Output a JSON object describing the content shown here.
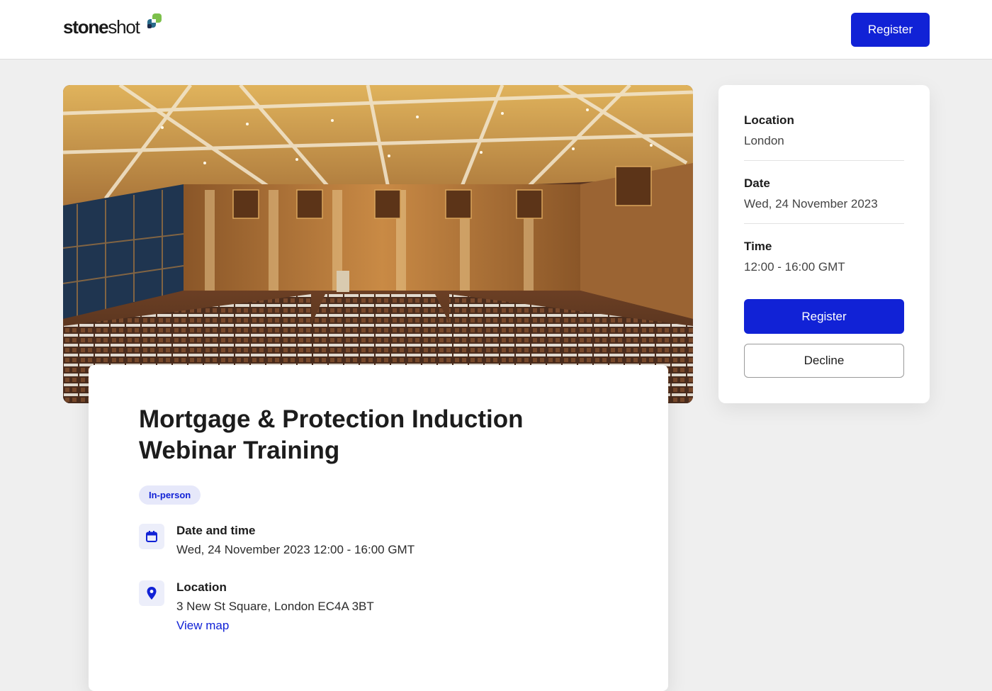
{
  "header": {
    "logo_bold": "stone",
    "logo_light": "shot",
    "register_label": "Register"
  },
  "event": {
    "title": "Mortgage & Protection Induction Webinar Training",
    "badge": "In-person",
    "hero_image": "conference-hall-photo",
    "date_time": {
      "label": "Date and time",
      "value": "Wed, 24 November 2023 12:00 - 16:00 GMT",
      "icon": "calendar-icon"
    },
    "location": {
      "label": "Location",
      "value": "3 New St Square, London EC4A 3BT",
      "link": "View map",
      "icon": "map-pin-icon"
    }
  },
  "sidebar": {
    "location": {
      "label": "Location",
      "value": "London"
    },
    "date": {
      "label": "Date",
      "value": "Wed, 24 November 2023"
    },
    "time": {
      "label": "Time",
      "value": "12:00 - 16:00 GMT"
    },
    "register_label": "Register",
    "decline_label": "Decline"
  },
  "colors": {
    "accent": "#1122d6",
    "badge_bg": "#e6e8fa",
    "page_bg": "#efefef"
  }
}
